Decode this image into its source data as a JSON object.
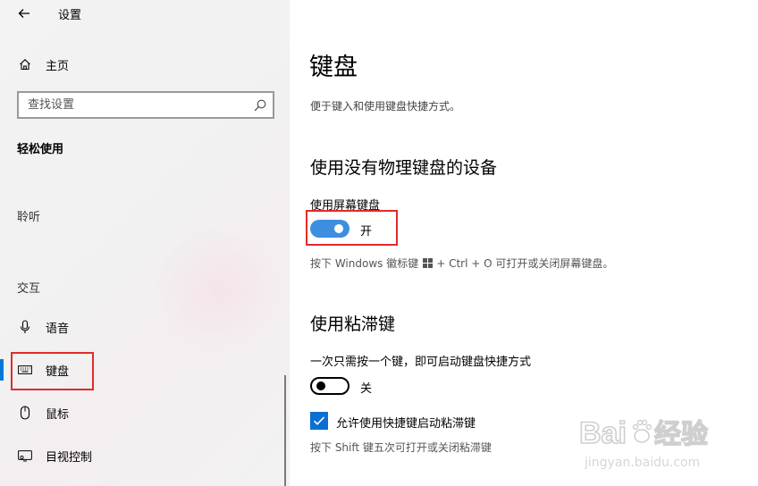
{
  "app_title": "设置",
  "sidebar": {
    "home_label": "主页",
    "search_placeholder": "查找设置",
    "section_heading": "轻松使用",
    "groups": {
      "hearing": "聆听",
      "interaction": "交互"
    },
    "items": [
      {
        "label": "语音",
        "icon": "microphone-icon"
      },
      {
        "label": "键盘",
        "icon": "keyboard-icon",
        "active": true
      },
      {
        "label": "鼠标",
        "icon": "mouse-icon"
      },
      {
        "label": "目视控制",
        "icon": "eye-control-icon"
      }
    ]
  },
  "main": {
    "title": "键盘",
    "description": "便于键入和使用键盘快捷方式。",
    "section1": {
      "heading": "使用没有物理键盘的设备",
      "setting_label": "使用屏幕键盘",
      "toggle_state": "开",
      "toggle_on": true,
      "hint_prefix": "按下 Windows 徽标键",
      "hint_suffix": "+ Ctrl + O 可打开或关闭屏幕键盘。"
    },
    "section2": {
      "heading": "使用粘滞键",
      "setting_label": "一次只需按一个键，即可启动键盘快捷方式",
      "toggle_state": "关",
      "toggle_on": false,
      "checkbox_label": "允许使用快捷键启动粘滞键",
      "checkbox_checked": true,
      "hint": "按下 Shift 键五次可打开或关闭粘滞键"
    }
  },
  "watermark": {
    "brand": "Bai",
    "brand2": "du",
    "brand_cn": "经验",
    "url": "jingyan.baidu.com"
  },
  "colors": {
    "accent": "#0078d7",
    "toggle_on": "#3d8ee0",
    "highlight": "#e02b2b"
  }
}
